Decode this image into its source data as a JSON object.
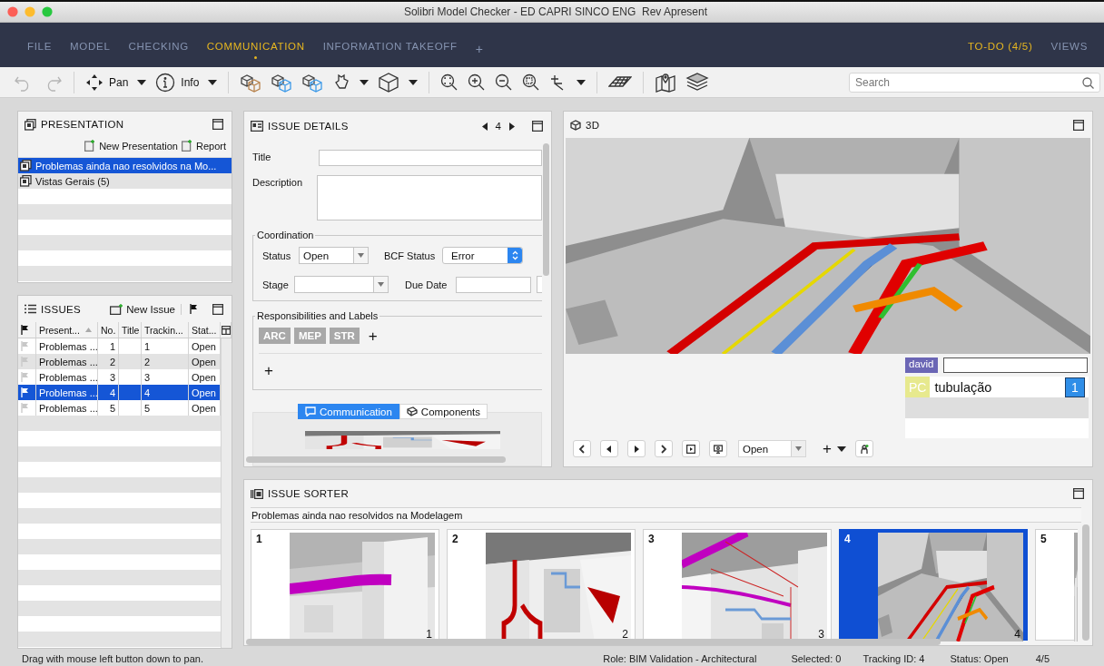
{
  "window": {
    "title": "Solibri Model Checker - ED CAPRI SINCO ENG  Rev Apresent"
  },
  "menu": {
    "items": [
      {
        "label": "FILE",
        "selected": false
      },
      {
        "label": "MODEL",
        "selected": false
      },
      {
        "label": "CHECKING",
        "selected": false
      },
      {
        "label": "COMMUNICATION",
        "selected": true
      },
      {
        "label": "INFORMATION TAKEOFF",
        "selected": false
      }
    ],
    "add": "+",
    "right": [
      {
        "label": "TO-DO (4/5)",
        "selected": true
      },
      {
        "label": "VIEWS",
        "selected": false
      }
    ]
  },
  "toolbar": {
    "undo": {
      "disabled": true
    },
    "redo": {
      "disabled": true
    },
    "pan": "Pan",
    "info": "Info",
    "search": {
      "placeholder": "Search"
    }
  },
  "presentation": {
    "title": "PRESENTATION",
    "actions": [
      "New Presentation",
      "Report"
    ],
    "items": [
      {
        "label": "Problemas ainda nao resolvidos na Mo...",
        "selected": true
      },
      {
        "label": "Vistas Gerais (5)",
        "selected": false
      }
    ]
  },
  "issues": {
    "title": "ISSUES",
    "new_issue": "New Issue",
    "columns": [
      "Present...",
      "No.",
      "Title",
      "Trackin...",
      "Stat..."
    ],
    "rows": [
      {
        "presentation": "Problemas ...",
        "no": "1",
        "tracking": "1",
        "status": "Open",
        "selected": false
      },
      {
        "presentation": "Problemas ...",
        "no": "2",
        "tracking": "2",
        "status": "Open",
        "selected": false
      },
      {
        "presentation": "Problemas ...",
        "no": "3",
        "tracking": "3",
        "status": "Open",
        "selected": false
      },
      {
        "presentation": "Problemas ...",
        "no": "4",
        "tracking": "4",
        "status": "Open",
        "selected": true
      },
      {
        "presentation": "Problemas ...",
        "no": "5",
        "tracking": "5",
        "status": "Open",
        "selected": false
      }
    ]
  },
  "issue_details": {
    "title": "ISSUE DETAILS",
    "number": "4",
    "title_label": "Title",
    "description_label": "Description",
    "coordination": {
      "legend": "Coordination",
      "status_label": "Status",
      "status": "Open",
      "bcf_label": "BCF Status",
      "bcf_status": "Error",
      "stage_label": "Stage",
      "due_label": "Due Date"
    },
    "responsibilities": {
      "legend": "Responsibilities and Labels",
      "labels": [
        "ARC",
        "MEP",
        "STR"
      ],
      "add_label": "+",
      "add_responsibility": "+"
    },
    "tabs": [
      {
        "label": "Communication",
        "selected": true
      },
      {
        "label": "Components",
        "selected": false
      }
    ]
  },
  "view_3d": {
    "title": "3D",
    "comment": {
      "author": "david",
      "tag": "PC",
      "text": "tubulação",
      "count": "1"
    },
    "status": "Open",
    "add": "+"
  },
  "issue_sorter": {
    "title": "ISSUE SORTER",
    "presentation": "Problemas ainda nao resolvidos na Modelagem",
    "thumbnails": [
      {
        "number": "1",
        "corner": "1",
        "selected": false
      },
      {
        "number": "2",
        "corner": "2",
        "selected": false
      },
      {
        "number": "3",
        "corner": "3",
        "selected": false
      },
      {
        "number": "4",
        "corner": "4",
        "selected": true
      },
      {
        "number": "5",
        "selected": false
      }
    ]
  },
  "status_bar": {
    "hint": "Drag with mouse left button down to pan.",
    "role": "Role: BIM Validation - Architectural",
    "selected": "Selected: 0",
    "tracking": "Tracking ID: 4",
    "status": "Status: Open",
    "position": "4/5"
  }
}
